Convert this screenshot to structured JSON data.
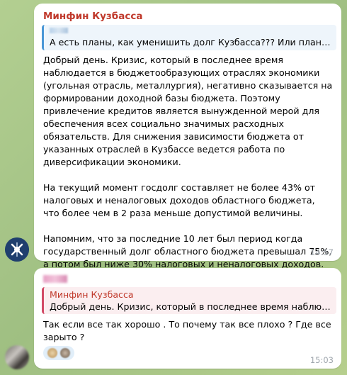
{
  "message1": {
    "sender": "Минфин Кузбасса",
    "reply_text": "А есть планы, как уменишить долг Кузбасса??? Или планы только увеличивать?",
    "body": "Добрый день. Кризис, который в последнее время наблюдается в бюджетообразующих отраслях экономики (угольная отрасль, металлургия), негативно сказывается на формировании доходной базы бюджета. Поэтому привлечение кредитов является вынужденной мерой для обеспечения всех социально значимых расходных обязательств. Для снижения зависимости бюджета от указанных отраслей в Кузбассе ведется работа по диверсификации экономики.\n\nНа текущий момент госдолг составляет не более 43% от налоговых и неналоговых доходов областного бюджета, что более чем в 2 раза меньше допустимой величины.\n\nНапомним, что за последние 10 лет был период когда государственный долг областного бюджета превышал 75%, а потом был ниже 30% налоговых и неналоговых доходов.",
    "time": "14:57"
  },
  "message2": {
    "reply_name": "Минфин Кузбасса",
    "reply_text": "Добрый день. Кризис, который в последнее время наблюдается в бюджетообразующих отраслях",
    "body": "Так если все так хорошо . То почему так все плохо ? Где все зарыто ?",
    "time": "15:03"
  },
  "colors": {
    "sender_name": "#c0392b",
    "reply_bar": "#4a97d6",
    "reply2_bar": "#d24a66",
    "timestamp": "#a0a7ae"
  }
}
